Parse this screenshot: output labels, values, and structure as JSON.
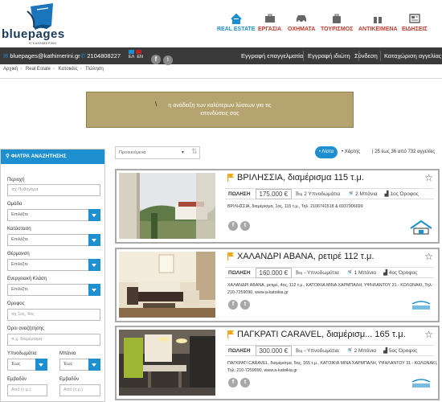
{
  "brand": {
    "name": "bluepages",
    "sub": "Η ΚΑΘΗΜΕΡΙΝΗ"
  },
  "nav": [
    {
      "label": "REAL ESTATE",
      "icon": "house-icon",
      "active": true
    },
    {
      "label": "ΕΡΓΑΣΙΑ",
      "icon": "briefcase-icon"
    },
    {
      "label": "ΟΧΗΜΑΤΑ",
      "icon": "car-icon"
    },
    {
      "label": "ΤΟΥΡΙΣΜΟΣ",
      "icon": "suitcase-icon"
    },
    {
      "label": "ΑΝΤΙΚΕΙΜΕΝΑ",
      "icon": "gift-icon"
    },
    {
      "label": "ΕΙΔΗΣΕΙΣ",
      "icon": "newspaper-icon"
    }
  ],
  "topbar": {
    "email": "bluepages@kathimerini.gr",
    "phone": "2104808227",
    "lang_el": "ΕΛ",
    "lang_en": "EN",
    "links": [
      "Εγγραφή επαγγελματία",
      "Εγγραφή ιδιώτη",
      "Σύνδεση",
      "Καταχώριση αγγελίας"
    ]
  },
  "breadcrumb": [
    "Αρχική",
    "Real Estate",
    "Κατοικίες",
    "Πώληση"
  ],
  "banner": {
    "line1": "η ανάδειξη των καλύτερων λύσεων για τις",
    "line2": "επενδύσεις σας"
  },
  "sidebar": {
    "title": "ΦΙΛΤΡΑ ΑΝΑΖΗΤΗΣΗΣ",
    "area_label": "Περιοχή",
    "area_placeholder": "πχ Πυθαγόρα",
    "group_label": "Ομάδα",
    "group_value": "Επιλέξτε",
    "status_label": "Κατάσταση",
    "status_value": "Επιλέξτε",
    "heating_label": "Θέρμανση",
    "heating_value": "Επιλέξτε",
    "energy_label": "Ενεργειακή Κλάση",
    "energy_value": "Επιλέξτε",
    "floor_label": "Όροφος",
    "floor_placeholder": "πχ 1ος, 4ος",
    "search_label": "Όροι αναζήτησης",
    "search_placeholder": "π.χ. διαμέρισμα",
    "bedrooms_label": "Υπνοδωμάτια",
    "bedrooms_value": "Έως",
    "baths_label": "Μπάνια",
    "baths_value": "Έως",
    "area_from_label": "Εμβαδόν",
    "area_from_placeholder": "Από (τ.μ.)",
    "area_to_label": "Εμβαδόν",
    "area_to_placeholder": "Από (τ.μ.)"
  },
  "controls": {
    "sort_value": "Προτεινόμενα",
    "list_label": "Λίστα",
    "map_label": "Χάρτης",
    "count": "25 έως 36 από 732 αγγελίες"
  },
  "listings": [
    {
      "title": "ΒΡΙΛΗΣΣΙΑ, διαμέρισμα 115 τ.μ.",
      "city": "ΠΩΛΗΣΗ",
      "price": "175.000 €",
      "bedrooms": "2 Υπνοδωμάτια",
      "baths": "2 Μπάνια",
      "floor": "1ος Όροφος",
      "desc": "ΒΡΙΛΗΣΣΙΑ, διαμέρισμα, 1ος, 115 τ.μ., Τηλ. 2106741518 & 6937906699"
    },
    {
      "title": "ΧΑΛΑΝΔΡΙ ΑΒΑΝΑ, ρετιρέ 112 τ.μ.",
      "city": "ΠΩΛΗΣΗ",
      "price": "160.000 €",
      "bedrooms": "- Υπνοδωμάτια",
      "baths": "1 Μπάνια",
      "floor": "4ος Όροφος",
      "desc": "ΧΑΛΑΝΔΡΙ ΑΒΑΝΑ, ρετιρέ, 4ος, 112 τ.μ., ΚΑΤΟΙΚΙΑ ΜΙΝΑ ΧΑΡΜΠΑΛΗ, ΥΨΗΛΑΝΤΟΥ 31 - ΚΟΛΩΝΑΚΙ, Τηλ: 210-7259090, www.a-katoikia.gr"
    },
    {
      "title": "ΠΑΓΚΡΑΤΙ CARAVEL, διαμέρισμ... 165 τ.μ.",
      "city": "ΠΩΛΗΣΗ",
      "price": "300.000 €",
      "bedrooms": "- Υπνοδωμάτια",
      "baths": "2 Μπάνια",
      "floor": "5ος Όροφος",
      "desc": "ΠΑΓΚΡΑΤΙ CARAVEL, διαμέρισμα, 5ος, 165 τ.μ., ΚΑΤΟΙΚΙΑ ΜΙΝΑ ΧΑΡΜΠΑΛΗ, ΥΨΗΛΑΝΤΟΥ 31 - ΚΟΛΩΝΑΚΙ, Τηλ: 210-7259090, www.a-katoikia.gr"
    }
  ],
  "colors": {
    "accent": "#1e8fcf",
    "nav_red": "#c0392b",
    "banner": "#b5a46f",
    "flag": "#f0a81c"
  }
}
